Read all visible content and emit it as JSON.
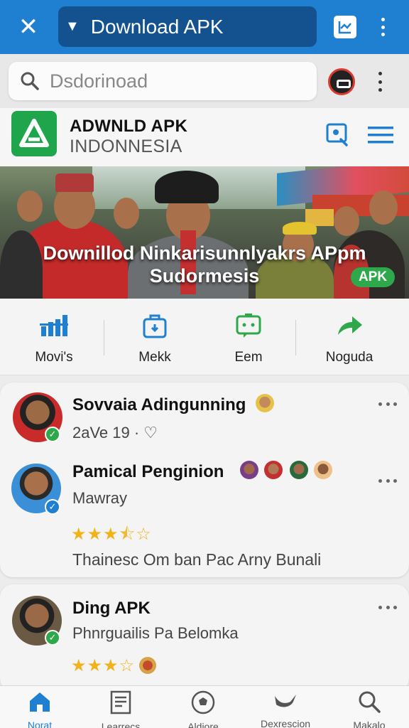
{
  "topbar": {
    "title": "Download APK",
    "icons": [
      "close-icon",
      "triangle-down-icon",
      "chart-icon",
      "more-vertical-icon"
    ]
  },
  "search": {
    "placeholder": "Dsdorinoad"
  },
  "app": {
    "name": "ADWNLD APK",
    "subtitle": "INDONNESIA"
  },
  "banner": {
    "title_line1": "Downillod Ninkarisunnlyakrs APpm",
    "title_line2": "Sudormesis",
    "badge": "APK"
  },
  "categories": [
    {
      "label": "Movi's",
      "icon": "bar-chart-icon"
    },
    {
      "label": "Mekk",
      "icon": "bag-icon"
    },
    {
      "label": "Eem",
      "icon": "chat-bubble-icon"
    },
    {
      "label": "Noguda",
      "icon": "share-arrow-icon"
    }
  ],
  "cards": [
    {
      "title": "Sovvaia Adingunning",
      "meta": "2aVe 19 · ♡"
    },
    {
      "title": "Pamical Penginion",
      "sub": "Mawray",
      "rating": 3.5,
      "desc": "Thainesc Om ban Pac Arny Bunali"
    },
    {
      "title": "Ding APK",
      "sub": "Phnrguailis Pa Belomka",
      "rating": 3.5
    }
  ],
  "bottom_nav": [
    {
      "label": "Norat",
      "icon": "home-icon",
      "active": true
    },
    {
      "label": "Learrecs",
      "icon": "document-icon",
      "active": false
    },
    {
      "label": "Aldiore",
      "icon": "soccer-ball-icon",
      "active": false
    },
    {
      "label": "Dexrescion",
      "icon": "bird-icon",
      "active": false
    },
    {
      "label": "Makalo",
      "icon": "search-icon",
      "active": false
    }
  ],
  "colors": {
    "primary": "#1f7fd1",
    "primary_dark": "#14528f",
    "green": "#2ea84a",
    "star": "#f2b21a"
  }
}
